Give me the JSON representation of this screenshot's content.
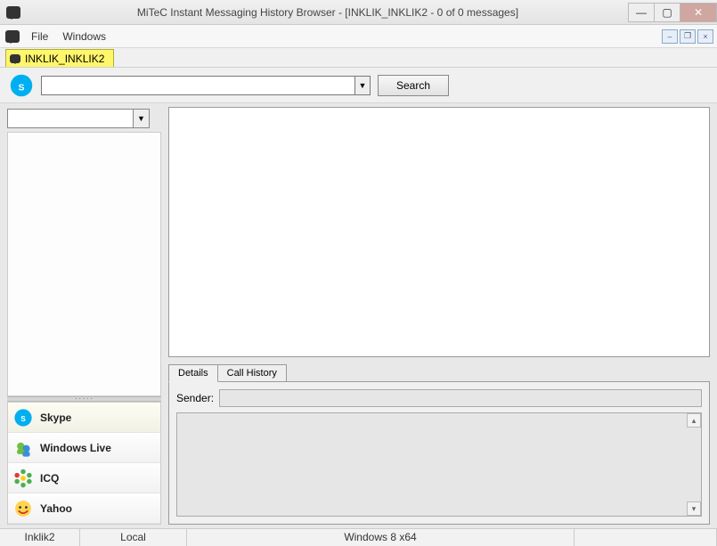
{
  "window": {
    "title": "MiTeC Instant Messaging History Browser - [INKLIK_INKLIK2 - 0 of 0 messages]"
  },
  "menu": {
    "file": "File",
    "windows": "Windows"
  },
  "mdi_tab": {
    "label": "INKLIK_INKLIK2"
  },
  "search": {
    "value": "",
    "button": "Search"
  },
  "contact_combo": {
    "value": ""
  },
  "services": [
    {
      "name": "Skype",
      "icon": "skype"
    },
    {
      "name": "Windows Live",
      "icon": "wlm"
    },
    {
      "name": "ICQ",
      "icon": "icq"
    },
    {
      "name": "Yahoo",
      "icon": "yahoo"
    }
  ],
  "detail_tabs": {
    "details": "Details",
    "call_history": "Call History"
  },
  "details_panel": {
    "sender_label": "Sender:",
    "sender_value": ""
  },
  "status": {
    "user": "Inklik2",
    "location": "Local",
    "os": "Windows 8 x64"
  }
}
